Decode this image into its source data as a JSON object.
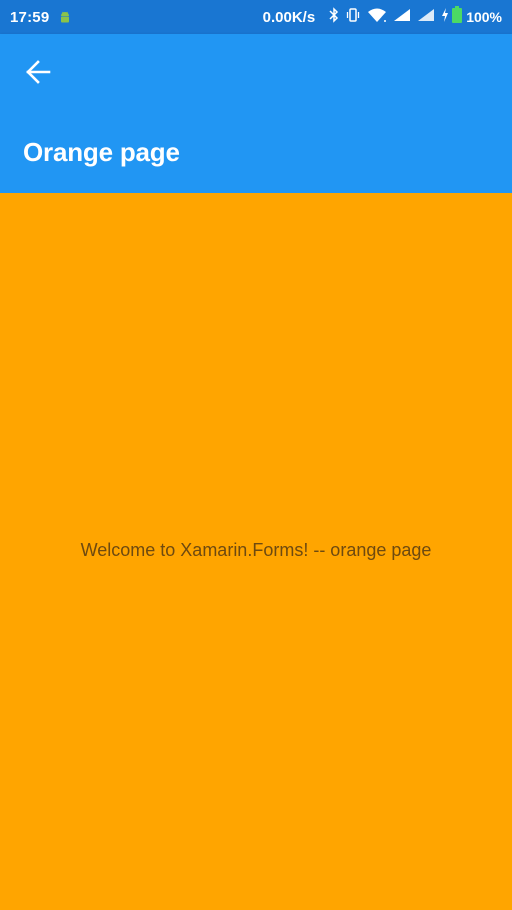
{
  "status_bar": {
    "time": "17:59",
    "net_speed": "0.00K/s",
    "battery_percent": "100%",
    "icons": [
      "android-notification-icon",
      "bluetooth-icon",
      "vibrate-icon",
      "wifi-icon",
      "signal-icon",
      "signal-icon",
      "charging-icon",
      "battery-icon"
    ]
  },
  "app_bar": {
    "back_icon": "arrow-left-icon",
    "title": "Orange page"
  },
  "content": {
    "welcome_text": "Welcome to Xamarin.Forms! -- orange page"
  },
  "colors": {
    "status_bar": "#1976D2",
    "app_bar": "#2196F3",
    "page_background": "#FFA500",
    "label_text": "#6E4A10",
    "battery": "#4CD964"
  }
}
